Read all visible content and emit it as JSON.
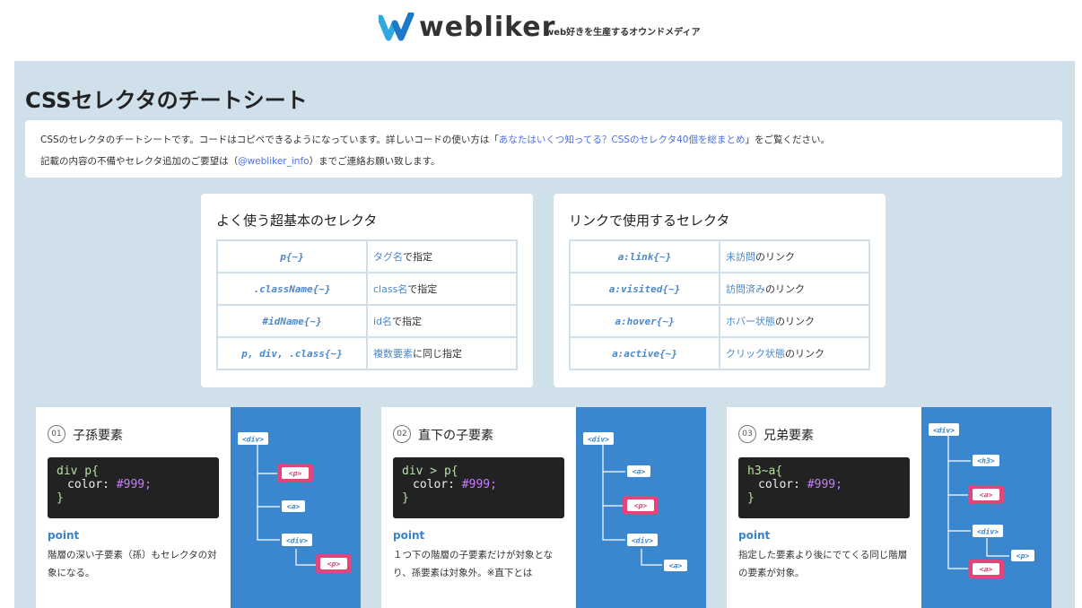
{
  "header": {
    "logo_text": "webliker",
    "tagline": "web好きを生産するオウンドメディア"
  },
  "colors": {
    "accent": "#3a87cf",
    "page_bg": "#cfe0ea",
    "tag_pink": "#e0457b"
  },
  "page": {
    "title": "CSSセレクタのチートシート",
    "intro": {
      "line1_prefix": "CSSのセレクタのチートシートです。コードはコピペできるようになっています。詳しいコードの使い方は「",
      "line1_link": "あなたはいくつ知ってる？CSSのセレクタ40個を総まとめ",
      "line1_suffix": "」をご覧ください。",
      "line2_prefix": "記載の内容の不備やセレクタ追加のご要望は（",
      "line2_link": "@webliker_info",
      "line2_suffix": "）までご連絡お願い致します。"
    }
  },
  "basic_selectors": {
    "title": "よく使う超基本のセレクタ",
    "rows": [
      {
        "code": "p{~}",
        "hl": "タグ名",
        "rest": "で指定"
      },
      {
        "code": ".className{~}",
        "hl": "class名",
        "rest": "で指定"
      },
      {
        "code": "#idName{~}",
        "hl": "id名",
        "rest": "で指定"
      },
      {
        "code": "p, div, .class{~}",
        "hl": "複数要素",
        "rest": "に同じ指定"
      }
    ]
  },
  "link_selectors": {
    "title": "リンクで使用するセレクタ",
    "rows": [
      {
        "code": "a:link{~}",
        "hl": "未訪問",
        "rest": "のリンク"
      },
      {
        "code": "a:visited{~}",
        "hl": "訪問済み",
        "rest": "のリンク"
      },
      {
        "code": "a:hover{~}",
        "hl": "ホバー状態",
        "rest": "のリンク"
      },
      {
        "code": "a:active{~}",
        "hl": "クリック状態",
        "rest": "のリンク"
      }
    ]
  },
  "relations": [
    {
      "num": "01",
      "title": "子孫要素",
      "code_selector": "div p{",
      "code_prop": "color: ",
      "code_val": "#999;",
      "code_close": "}",
      "point_label": "point",
      "point_text": "階層の深い子要素（孫）もセレクタの対象になる。",
      "tags": [
        "<div>",
        "<p>",
        "<a>",
        "<div>",
        "<p>"
      ]
    },
    {
      "num": "02",
      "title": "直下の子要素",
      "code_selector": "div > p{",
      "code_prop": "color: ",
      "code_val": "#999;",
      "code_close": "}",
      "point_label": "point",
      "point_text": "１つ下の階層の子要素だけが対象となり、孫要素は対象外。※直下とは",
      "tags": [
        "<div>",
        "<a>",
        "<p>",
        "<div>",
        "<a>"
      ]
    },
    {
      "num": "03",
      "title": "兄弟要素",
      "code_selector": "h3~a{",
      "code_prop": "color: ",
      "code_val": "#999;",
      "code_close": "}",
      "point_label": "point",
      "point_text": "指定した要素より後にでてくる同じ階層の要素が対象。",
      "tags": [
        "<div>",
        "<h3>",
        "<a>",
        "<div>",
        "<p>",
        "<a>"
      ]
    }
  ]
}
